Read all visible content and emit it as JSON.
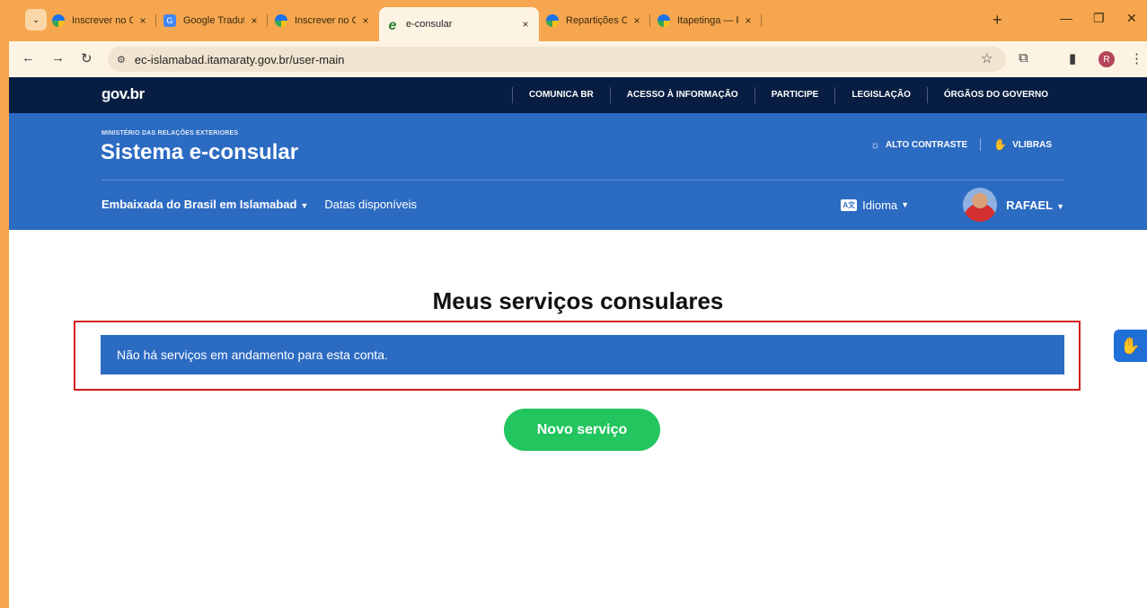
{
  "browser": {
    "tabs": [
      {
        "title": "Inscrever no CPF no e",
        "active": false,
        "favicon": "gov-icon"
      },
      {
        "title": "Google Tradutor",
        "active": false,
        "favicon": "translate-icon"
      },
      {
        "title": "Inscrever no CPF no e",
        "active": false,
        "favicon": "gov-icon"
      },
      {
        "title": "e-consular",
        "active": true,
        "favicon": "e-icon"
      },
      {
        "title": "Repartições Consular",
        "active": false,
        "favicon": "gov-icon"
      },
      {
        "title": "Itapetinga — Receita",
        "active": false,
        "favicon": "gov-icon"
      }
    ],
    "close_glyph": "×",
    "new_tab_glyph": "+",
    "url": "ec-islamabad.itamaraty.gov.br/user-main",
    "profile_initial": "R"
  },
  "govbar": {
    "logo": "gov.br",
    "links": [
      "COMUNICA BR",
      "ACESSO À INFORMAÇÃO",
      "PARTICIPE",
      "LEGISLAÇÃO",
      "ÓRGÃOS DO GOVERNO"
    ]
  },
  "header": {
    "ministry": "MINISTÉRIO DAS RELAÇÕES EXTERIORES",
    "title": "Sistema e-consular",
    "contrast": "ALTO CONTRASTE",
    "vlibras": "VLIBRAS",
    "embassy": "Embaixada do Brasil em Islamabad",
    "dates": "Datas disponíveis",
    "language": "Idioma",
    "user": "RAFAEL"
  },
  "main": {
    "title": "Meus serviços consulares",
    "alert": "Não há serviços em andamento para esta conta.",
    "new_service": "Novo serviço"
  },
  "colors": {
    "gov_dark": "#071d41",
    "header_blue": "#2c6bc2",
    "button_green": "#22c55e",
    "highlight_red": "#d51c1c",
    "browser_frame": "#f5a64e"
  }
}
